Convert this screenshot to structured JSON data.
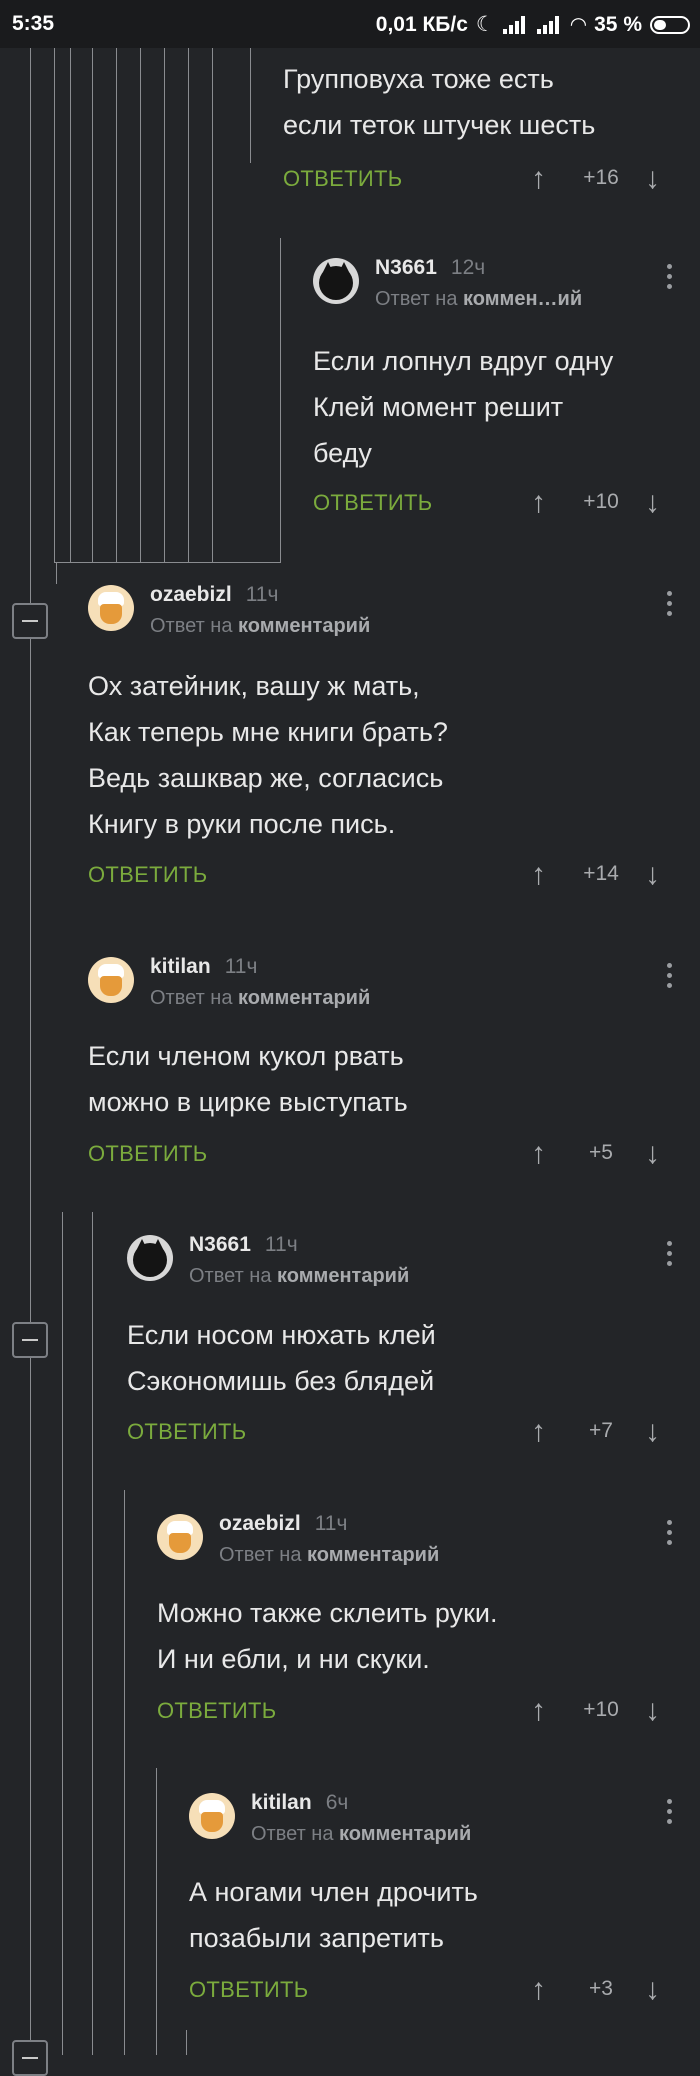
{
  "status": {
    "time": "5:35",
    "speed": "0,01 КБ/с",
    "battery": "35 %"
  },
  "reply_prefix": "Ответ на",
  "reply_label": "ОТВЕТИТЬ",
  "comments": [
    {
      "lines": [
        "Групповуха тоже есть",
        "если теток штучек шесть"
      ],
      "rating": "+16"
    },
    {
      "user": "N3661",
      "time": "12ч",
      "target": "коммен…ий",
      "lines": [
        "Если лопнул вдруг одну",
        "Клей момент решит",
        "беду"
      ],
      "rating": "+10"
    },
    {
      "user": "ozaebizl",
      "time": "11ч",
      "target": "комментарий",
      "lines": [
        "Ох затейник, вашу ж мать,",
        "Как теперь мне книги брать?",
        "Ведь зашквар же, согласись",
        "Книгу в руки после пись."
      ],
      "rating": "+14"
    },
    {
      "user": "kitilan",
      "time": "11ч",
      "target": "комментарий",
      "lines": [
        "Если членом кукол рвать",
        "можно в цирке выступать"
      ],
      "rating": "+5"
    },
    {
      "user": "N3661",
      "time": "11ч",
      "target": "комментарий",
      "lines": [
        "Если носом нюхать клей",
        "Сэкономишь без блядей"
      ],
      "rating": "+7"
    },
    {
      "user": "ozaebizl",
      "time": "11ч",
      "target": "комментарий",
      "lines": [
        "Можно также склеить руки.",
        "И ни ебли, и ни скуки."
      ],
      "rating": "+10"
    },
    {
      "user": "kitilan",
      "time": "6ч",
      "target": "комментарий",
      "lines": [
        "А ногами член дрочить",
        "позабыли запретить"
      ],
      "rating": "+3"
    }
  ]
}
